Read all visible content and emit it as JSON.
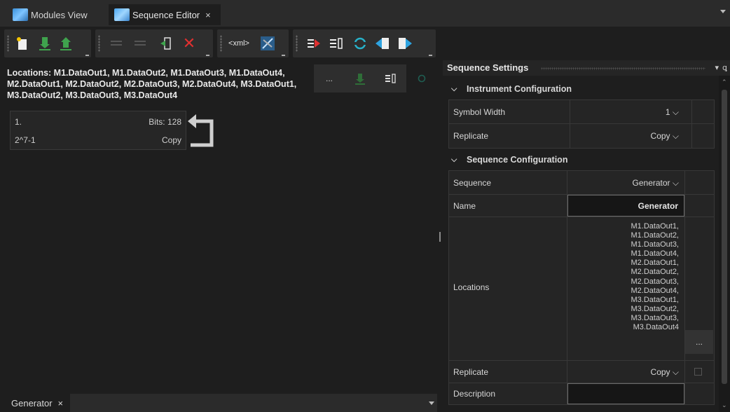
{
  "tabs": [
    {
      "label": "Modules View",
      "icon": "modules-icon",
      "active": false
    },
    {
      "label": "Sequence Editor",
      "icon": "sequence-editor-icon",
      "active": true,
      "close": "×"
    }
  ],
  "toolbar": {
    "xml_label": "<xml>"
  },
  "left": {
    "locations_text": "Locations: M1.DataOut1, M1.DataOut2, M1.DataOut3, M1.DataOut4, M2.DataOut1, M2.DataOut2, M2.DataOut3, M2.DataOut4, M3.DataOut1, M3.DataOut2, M3.DataOut3, M3.DataOut4",
    "ellipsis_label": "...",
    "sequence_block": {
      "index": "1.",
      "bits": "Bits: 128",
      "pattern": "2^7-1",
      "mode": "Copy"
    },
    "bottom_tab": {
      "label": "Generator",
      "close": "×"
    }
  },
  "right": {
    "title": "Sequence Settings",
    "pin": "▾",
    "dock": "ꟷ",
    "instrument": {
      "label": "Instrument Configuration",
      "rows": [
        {
          "label": "Symbol Width",
          "value": "1"
        },
        {
          "label": "Replicate",
          "value": "Copy"
        }
      ]
    },
    "sequence_config": {
      "label": "Sequence Configuration",
      "sequence": {
        "label": "Sequence",
        "value": "Generator"
      },
      "name": {
        "label": "Name",
        "value": "Generator"
      },
      "locations": {
        "label": "Locations",
        "values": [
          "M1.DataOut1,",
          "M1.DataOut2,",
          "M1.DataOut3,",
          "M1.DataOut4,",
          "M2.DataOut1,",
          "M2.DataOut2,",
          "M2.DataOut3,",
          "M2.DataOut4,",
          "M3.DataOut1,",
          "M3.DataOut2,",
          "M3.DataOut3,",
          "M3.DataOut4"
        ],
        "button": "..."
      },
      "replicate": {
        "label": "Replicate",
        "value": "Copy"
      },
      "description": {
        "label": "Description",
        "value": ""
      }
    }
  },
  "colors": {
    "green": "#3fa34d",
    "red": "#e03030",
    "blue": "#2ea3e0",
    "cyan": "#27b1c9"
  }
}
